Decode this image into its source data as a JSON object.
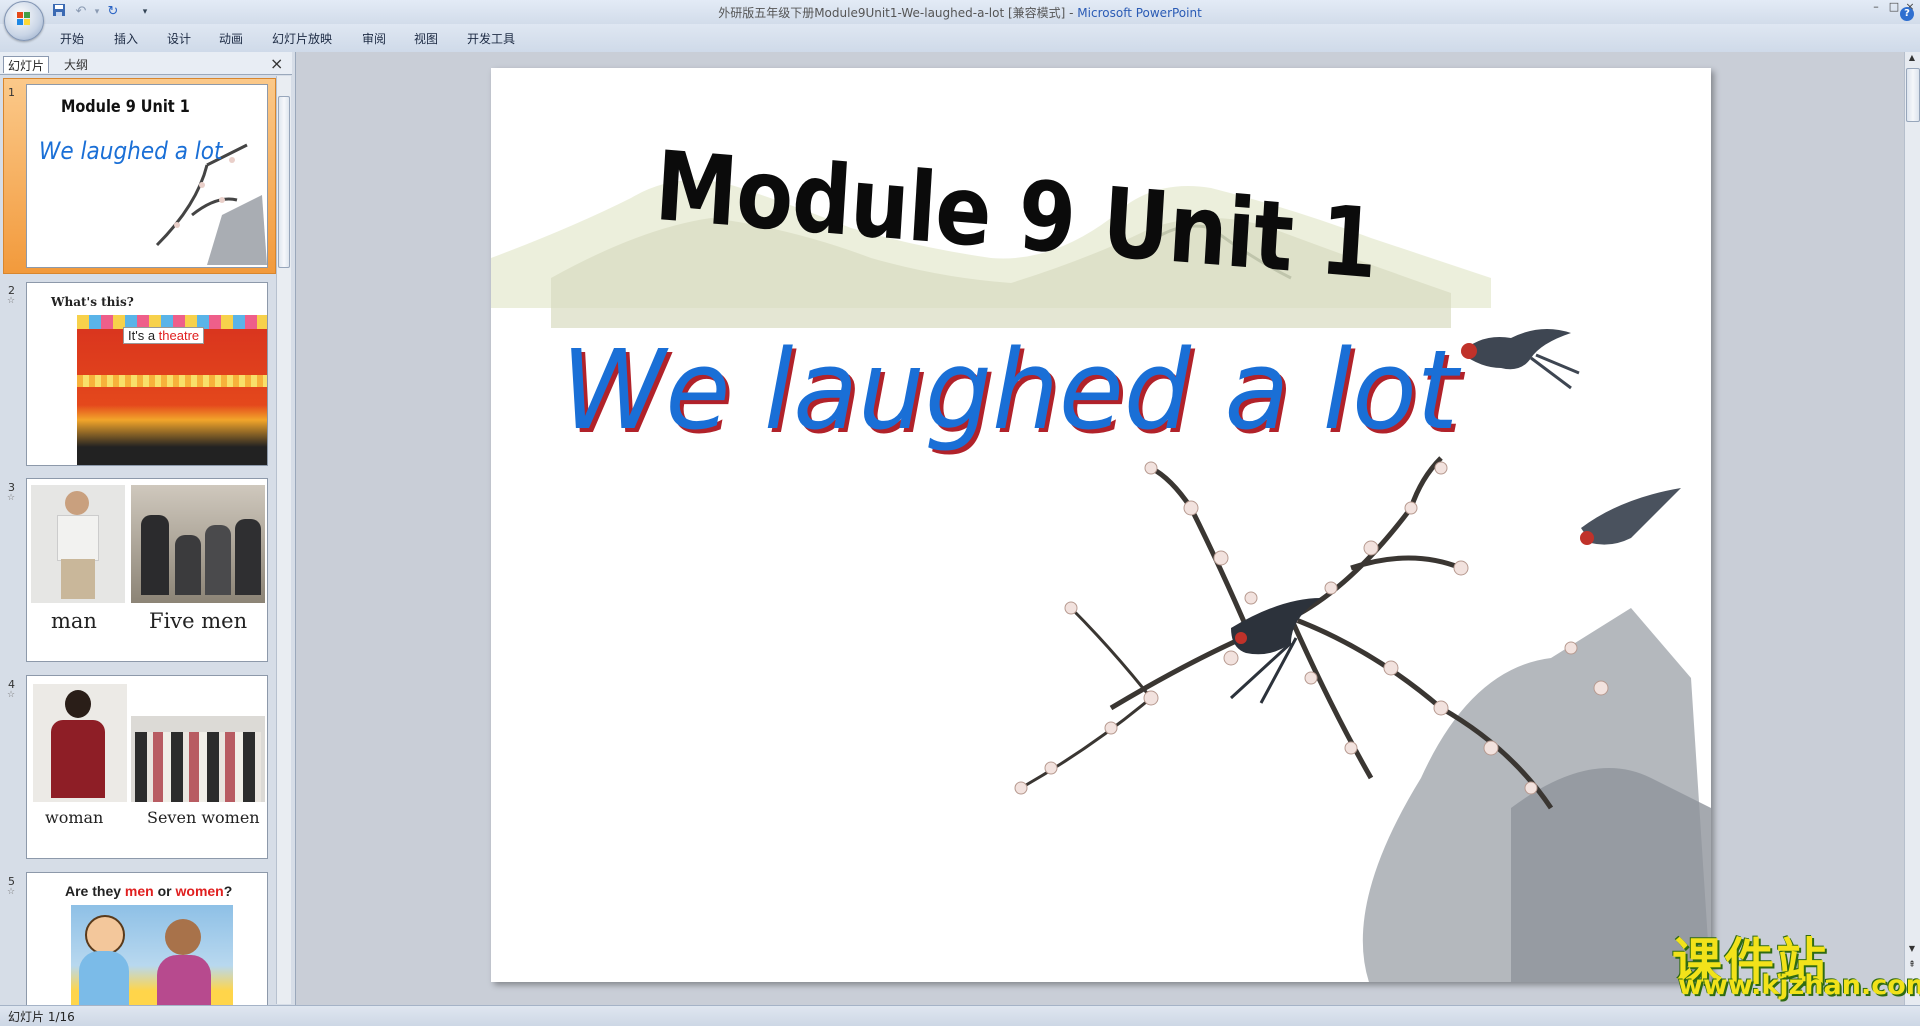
{
  "window": {
    "title_doc": "外研版五年级下册Module9Unit1-We-laughed-a-lot [兼容模式] - ",
    "title_app": "Microsoft PowerPoint",
    "controls": [
      "–",
      "□",
      "×"
    ]
  },
  "ribbon": {
    "tabs": [
      "开始",
      "插入",
      "设计",
      "动画",
      "幻灯片放映",
      "审阅",
      "视图",
      "开发工具"
    ],
    "help": "?"
  },
  "panel": {
    "tabs": [
      "幻灯片",
      "大纲"
    ],
    "close": "×",
    "slides": [
      {
        "num": "1",
        "title": "Module 9 Unit 1",
        "subtitle": "We laughed a lot"
      },
      {
        "num": "2",
        "question": "What's this?",
        "answer_prefix": "It's a ",
        "answer_word": "theatre"
      },
      {
        "num": "3",
        "left_label": "man",
        "right_label": "Five men"
      },
      {
        "num": "4",
        "left_label": "woman",
        "right_label": "Seven women"
      },
      {
        "num": "5",
        "q_prefix": "Are they ",
        "q_men": "men",
        "q_or": " or ",
        "q_women": "women",
        "q_end": "?"
      }
    ]
  },
  "slide": {
    "title": "Module 9 Unit 1",
    "subtitle": "We laughed a lot"
  },
  "status": {
    "text": "幻灯片 1/16"
  },
  "watermark": {
    "cn": "课件站",
    "url": "www.kjzhan.com"
  },
  "colors": {
    "subtitle_blue": "#1a6fd6",
    "subtitle_shadow": "#b1222a",
    "accent_red": "#e02020"
  }
}
